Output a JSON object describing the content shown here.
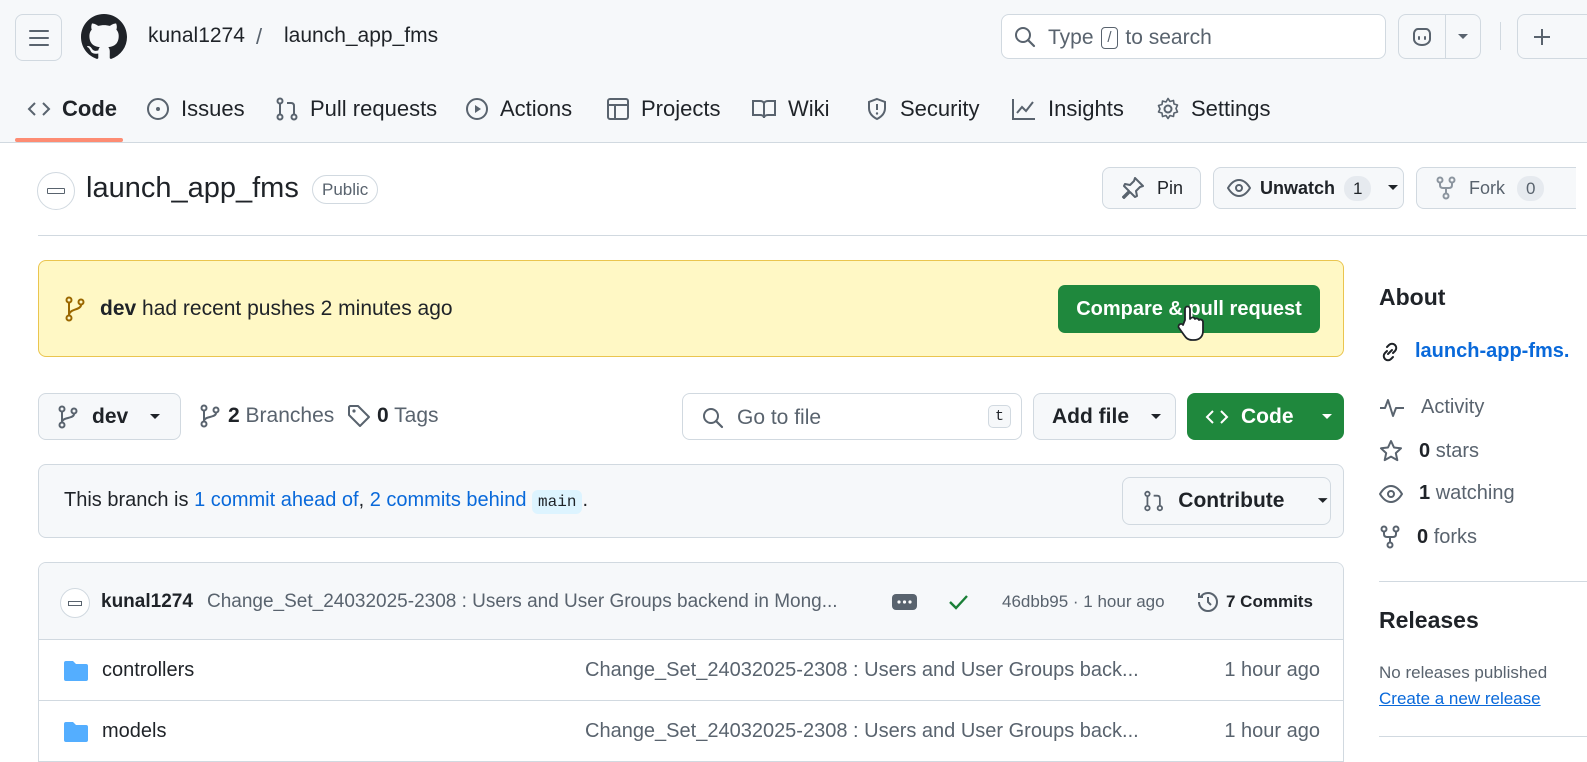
{
  "header": {
    "owner": "kunal1274",
    "separator": "/",
    "repo": "launch_app_fms",
    "search": {
      "before": "Type",
      "key": "/",
      "after": "to search"
    }
  },
  "tabs": [
    {
      "label": "Code",
      "icon": "code-icon"
    },
    {
      "label": "Issues",
      "icon": "issue-icon"
    },
    {
      "label": "Pull requests",
      "icon": "pull-request-icon"
    },
    {
      "label": "Actions",
      "icon": "play-icon"
    },
    {
      "label": "Projects",
      "icon": "table-icon"
    },
    {
      "label": "Wiki",
      "icon": "book-icon"
    },
    {
      "label": "Security",
      "icon": "shield-icon"
    },
    {
      "label": "Insights",
      "icon": "graph-icon"
    },
    {
      "label": "Settings",
      "icon": "gear-icon"
    }
  ],
  "repo": {
    "title": "launch_app_fms",
    "visibility": "Public",
    "pin_label": "Pin",
    "unwatch_label": "Unwatch",
    "watch_count": "1",
    "fork_label": "Fork",
    "fork_count": "0"
  },
  "banner": {
    "branch": "dev",
    "text": "had recent pushes 2 minutes ago",
    "button": "Compare & pull request"
  },
  "toolbar": {
    "branch": "dev",
    "branches_count": "2",
    "branches_label": "Branches",
    "tags_count": "0",
    "tags_label": "Tags",
    "goto_placeholder": "Go to file",
    "goto_key": "t",
    "add_file": "Add file",
    "code": "Code"
  },
  "ahead": {
    "prefix": "This branch is ",
    "ahead_link": "1 commit ahead of",
    "comma": ", ",
    "behind_link": "2 commits behind",
    "base": "main",
    "suffix": ".",
    "contribute": "Contribute"
  },
  "latest_commit": {
    "author": "kunal1274",
    "message": "Change_Set_24032025-2308 : Users and User Groups backend in Mong...",
    "sha_time": "46dbb95 · 1 hour ago",
    "commits": "7 Commits"
  },
  "files": [
    {
      "name": "controllers",
      "message": "Change_Set_24032025-2308 : Users and User Groups back...",
      "time": "1 hour ago"
    },
    {
      "name": "models",
      "message": "Change_Set_24032025-2308 : Users and User Groups back...",
      "time": "1 hour ago"
    }
  ],
  "sidebar": {
    "about": "About",
    "link": "launch-app-fms.",
    "activity": "Activity",
    "stars_count": "0",
    "stars_label": "stars",
    "watching_count": "1",
    "watching_label": "watching",
    "forks_count": "0",
    "forks_label": "forks",
    "releases": "Releases",
    "no_releases": "No releases published",
    "create_release": "Create a new release"
  },
  "colors": {
    "accent_green": "#1f883d",
    "link_blue": "#0969da",
    "tab_underline": "#fd8c73",
    "banner_bg": "#fff8c5"
  }
}
